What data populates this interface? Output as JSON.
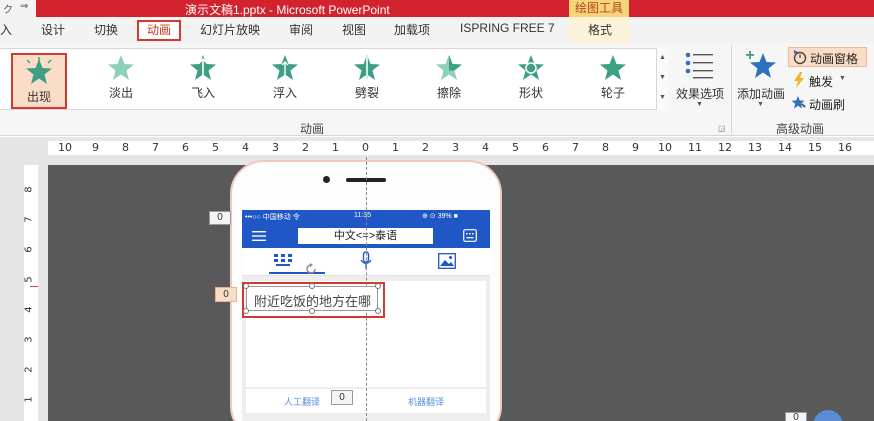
{
  "titlebar": {
    "title": "演示文稿1.pptx - Microsoft PowerPoint",
    "context_tab": "绘图工具",
    "left_glyph": "ク",
    "left_arrow": "⇒"
  },
  "tabs": {
    "insert_partial": "入",
    "design": "设计",
    "transitions": "切换",
    "animation": "动画",
    "slideshow": "幻灯片放映",
    "review": "审阅",
    "view": "视图",
    "addins": "加载项",
    "ispring": "ISPRING FREE 7",
    "format": "格式"
  },
  "ribbon": {
    "animations": [
      {
        "label": "出现",
        "color": "#3e9e86"
      },
      {
        "label": "淡出",
        "color": "#8fd0bd"
      },
      {
        "label": "飞入",
        "color": "#3e9e86"
      },
      {
        "label": "浮入",
        "color": "#3e9e86"
      },
      {
        "label": "劈裂",
        "color": "#3e9e86"
      },
      {
        "label": "擦除",
        "color": "#8fd0bd"
      },
      {
        "label": "形状",
        "color": "#3e9e86"
      },
      {
        "label": "轮子",
        "color": "#3e9e86"
      }
    ],
    "effect_options": "效果选项",
    "group_animation": "动画",
    "add_animation": "添加动画",
    "animation_pane": "动画窗格",
    "trigger": "触发",
    "animation_painter": "动画刷",
    "group_advanced": "高级动画",
    "accent": "#d23a30",
    "highlight_fill": "#fbdcc6"
  },
  "ruler": {
    "h_labels": [
      "10",
      "9",
      "8",
      "7",
      "6",
      "5",
      "4",
      "3",
      "2",
      "1",
      "0",
      "1",
      "2",
      "3",
      "4",
      "5",
      "6",
      "7",
      "8",
      "9",
      "10",
      "11",
      "12",
      "13",
      "14",
      "15",
      "16"
    ],
    "v_labels": [
      "8",
      "7",
      "6",
      "5",
      "4",
      "3",
      "2",
      "1"
    ]
  },
  "phone": {
    "status_left": "•••○○ 中国移动 令",
    "status_time": "11:35",
    "status_right": "⊕ ⊙ 39% ■",
    "lang_label": "中文<=>泰语",
    "input_text": "附近吃饭的地方在哪",
    "human_translate": "人工翻译",
    "machine_translate": "机器翻译",
    "brand_blue": "#1f57c6"
  },
  "tags": {
    "left_0": "0",
    "text_0": "0",
    "btn_0": "0",
    "br": "0"
  }
}
